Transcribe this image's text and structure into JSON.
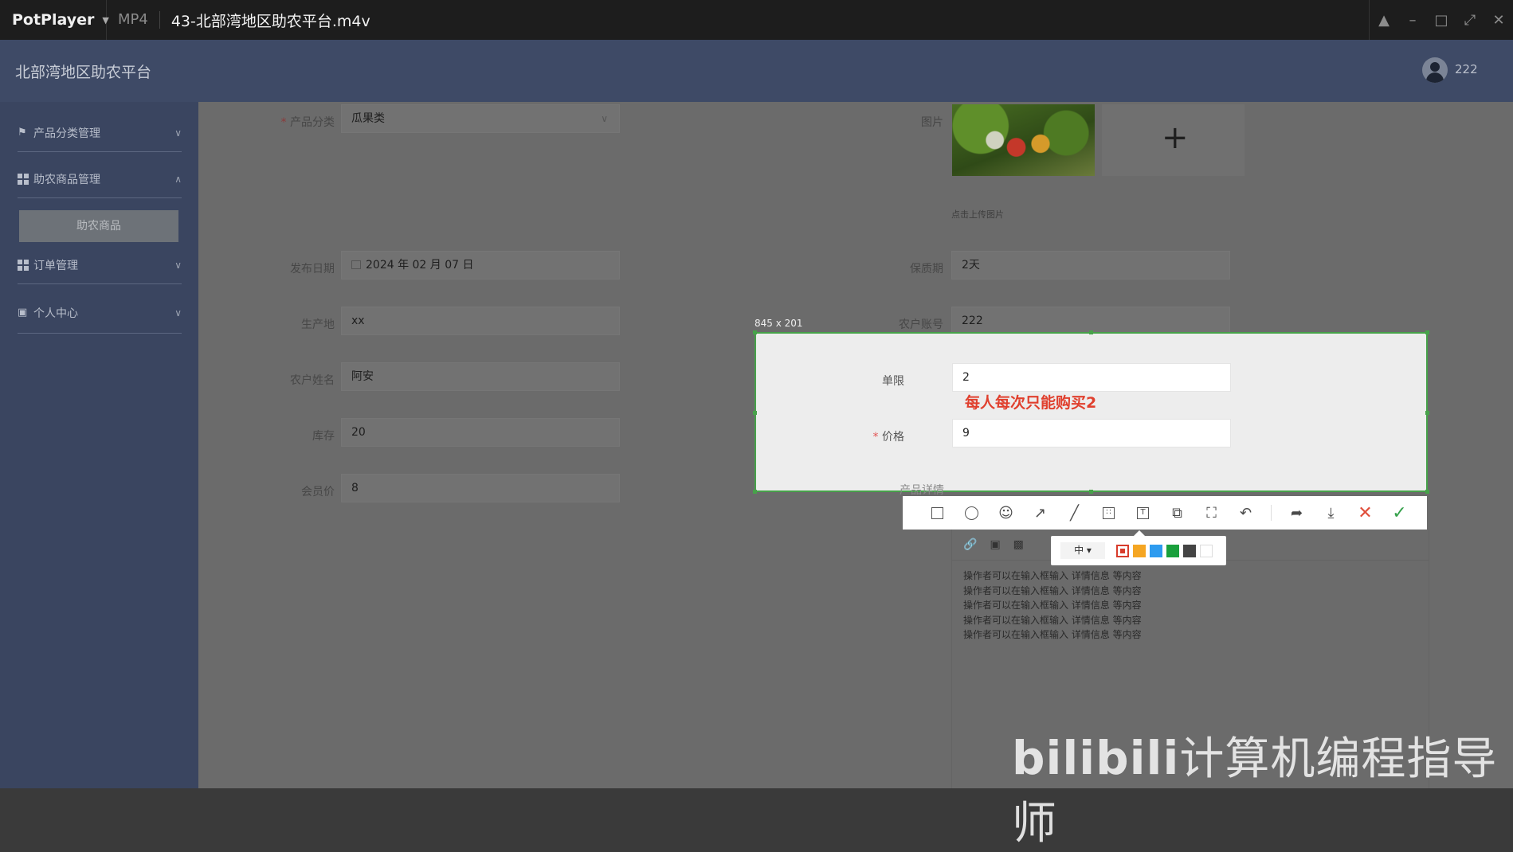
{
  "player": {
    "brand": "PotPlayer",
    "format": "MP4",
    "file_title": "43-北部湾地区助农平台.m4v",
    "controls": [
      "pin-icon",
      "minimize-icon",
      "maximize-icon",
      "fullscreen-icon",
      "close-icon"
    ]
  },
  "app": {
    "title": "北部湾地区助农平台",
    "user_name": "222"
  },
  "sidebar": {
    "items": [
      {
        "label": "产品分类管理",
        "icon": "flag-icon",
        "expanded": false
      },
      {
        "label": "助农商品管理",
        "icon": "grid-icon",
        "expanded": true
      },
      {
        "label": "订单管理",
        "icon": "grid-icon",
        "expanded": false
      },
      {
        "label": "个人中心",
        "icon": "calendar-icon",
        "expanded": false
      }
    ],
    "submenu_active": "助农商品"
  },
  "form": {
    "category_label": "产品分类",
    "category_value": "瓜果类",
    "image_label": "图片",
    "upload_hint": "点击上传图片",
    "publish_date_label": "发布日期",
    "publish_date_value": "2024 年 02 月 07 日",
    "shelf_life_label": "保质期",
    "shelf_life_value": "2天",
    "origin_label": "生产地",
    "origin_value": "xx",
    "farmer_account_label": "农户账号",
    "farmer_account_value": "222",
    "farmer_name_label": "农户姓名",
    "farmer_name_value": "阿安",
    "stock_label": "库存",
    "stock_value": "20",
    "member_price_label": "会员价",
    "member_price_value": "8",
    "limit_label": "单限",
    "limit_value": "2",
    "price_label": "价格",
    "price_value": "9",
    "detail_label": "产品详情"
  },
  "capture": {
    "size_text": "845 x 201",
    "annotation_text": "每人每次只能购买2",
    "size_option": "中",
    "colors": [
      "#d83c2c",
      "#f5a623",
      "#2d9bef",
      "#1aa03c",
      "#444444",
      "#ffffff"
    ],
    "tools": [
      "rectangle-icon",
      "ellipse-icon",
      "emoji-icon",
      "arrow-icon",
      "pen-icon",
      "mosaic-icon",
      "text-icon",
      "copy-icon",
      "ocr-icon",
      "undo-icon",
      "share-icon",
      "save-icon",
      "cancel-icon",
      "confirm-icon"
    ]
  },
  "editor": {
    "lines": [
      "操作者可以在输入框输入 详情信息 等内容",
      "操作者可以在输入框输入 详情信息 等内容",
      "操作者可以在输入框输入 详情信息 等内容",
      "操作者可以在输入框输入 详情信息 等内容",
      "操作者可以在输入框输入 详情信息 等内容"
    ]
  },
  "watermark": {
    "logo": "bilibili",
    "channel": "计算机编程指导师"
  }
}
